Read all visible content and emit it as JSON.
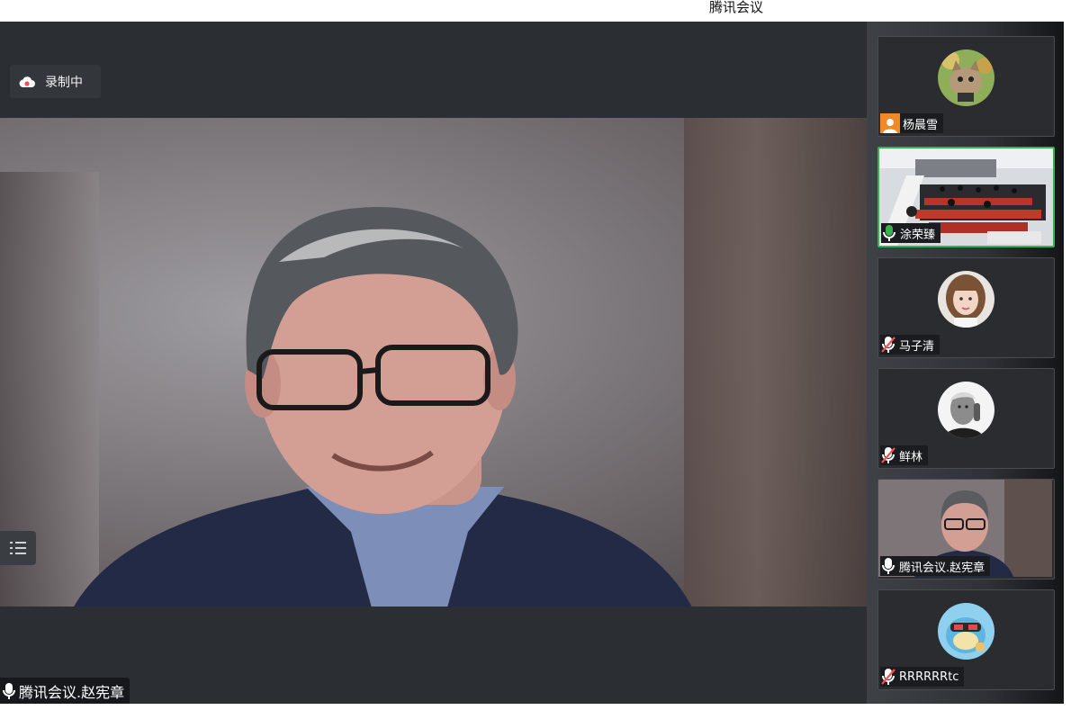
{
  "window": {
    "title": "腾讯会议"
  },
  "recording": {
    "label": "录制中"
  },
  "main_speaker": {
    "name": "腾讯会议.赵宪章"
  },
  "participants": [
    {
      "name": "杨晨雪"
    },
    {
      "name": "涂荣臻"
    },
    {
      "name": "马子清"
    },
    {
      "name": "鲜林"
    },
    {
      "name": "腾讯会议.赵宪章"
    },
    {
      "name": "RRRRRRtc"
    }
  ],
  "colors": {
    "active_border": "#37b24d",
    "user_badge": "#f08a24",
    "muted_mic": "#ff4d4f"
  }
}
